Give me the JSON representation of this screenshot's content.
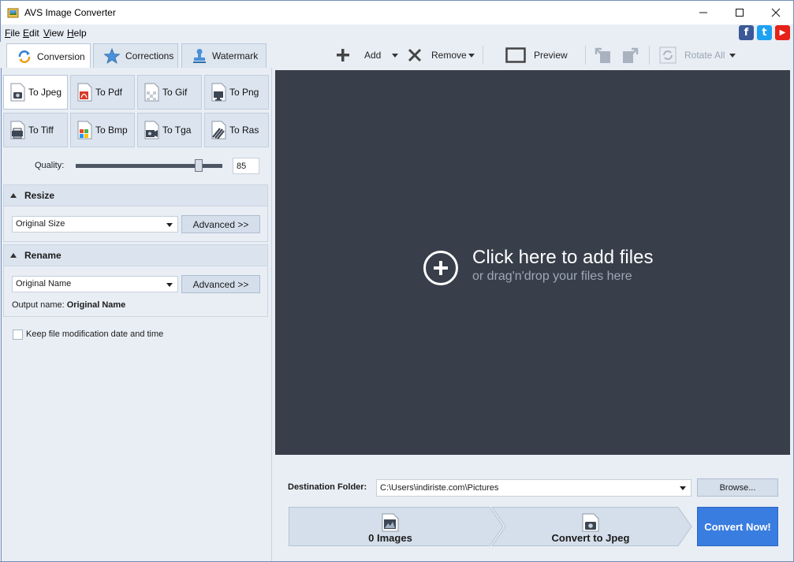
{
  "window": {
    "title": "AVS Image Converter"
  },
  "menu": {
    "items": [
      "File",
      "Edit",
      "View",
      "Help"
    ]
  },
  "social": {
    "icons": [
      "facebook-icon",
      "twitter-icon",
      "youtube-icon"
    ],
    "glyphs": [
      "f",
      "t",
      "▶"
    ],
    "colors": [
      "#3b5998",
      "#1da1f2",
      "#e62117"
    ]
  },
  "tabs": [
    {
      "label": "Conversion",
      "icon": "conversion-icon"
    },
    {
      "label": "Corrections",
      "icon": "star-icon"
    },
    {
      "label": "Watermark",
      "icon": "stamp-icon"
    }
  ],
  "toolbar": {
    "add_label": "Add",
    "remove_label": "Remove",
    "preview_label": "Preview",
    "rotate_all_label": "Rotate All"
  },
  "formats": [
    {
      "label": "To Jpeg",
      "icon": "jpeg-icon",
      "active": true
    },
    {
      "label": "To Pdf",
      "icon": "pdf-icon",
      "active": false
    },
    {
      "label": "To Gif",
      "icon": "gif-icon",
      "active": false
    },
    {
      "label": "To Png",
      "icon": "png-icon",
      "active": false
    },
    {
      "label": "To Tiff",
      "icon": "tiff-icon",
      "active": false
    },
    {
      "label": "To Bmp",
      "icon": "bmp-icon",
      "active": false
    },
    {
      "label": "To Tga",
      "icon": "tga-icon",
      "active": false
    },
    {
      "label": "To Ras",
      "icon": "ras-icon",
      "active": false
    }
  ],
  "quality": {
    "label": "Quality:",
    "value": "85",
    "slider_fraction": 0.84
  },
  "resize": {
    "title": "Resize",
    "selected": "Original Size",
    "advanced_label": "Advanced >>"
  },
  "rename": {
    "title": "Rename",
    "selected": "Original Name",
    "advanced_label": "Advanced >>",
    "output_label": "Output name:",
    "output_value": "Original Name"
  },
  "keep_date": {
    "label": "Keep file modification date and time",
    "checked": false
  },
  "drop_zone": {
    "title": "Click here to add files",
    "subtitle": "or drag'n'drop your files here"
  },
  "destination": {
    "label": "Destination Folder:",
    "path": "C:\\Users\\indiriste.com\\Pictures",
    "browse_label": "Browse..."
  },
  "steps": {
    "images_label": "0 Images",
    "convert_to_label": "Convert to Jpeg",
    "convert_now_label": "Convert Now!"
  },
  "colors": {
    "accent": "#3a7de0",
    "drop_zone_bg": "#383e4a",
    "panel_bg": "#e9eef5"
  }
}
